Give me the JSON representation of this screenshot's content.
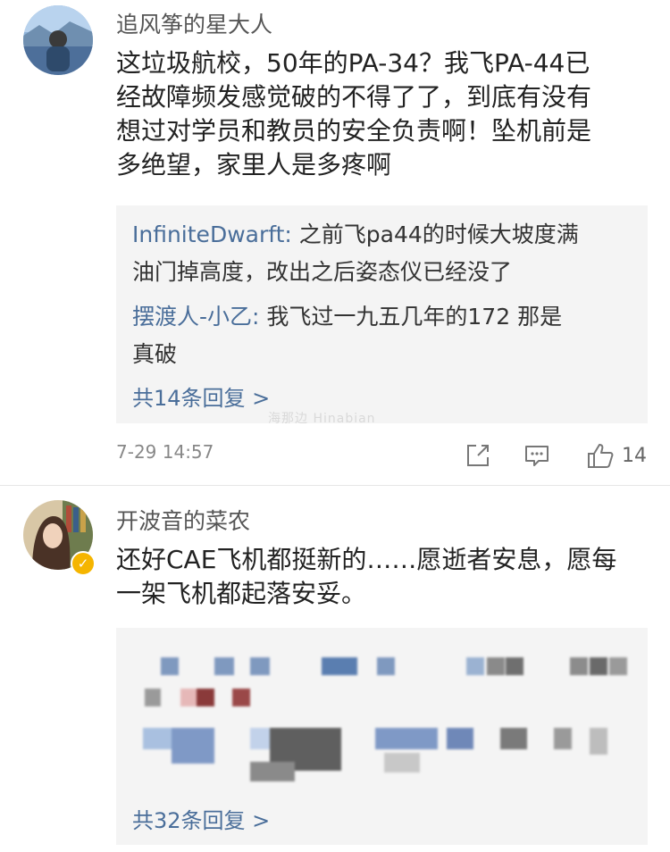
{
  "comments": [
    {
      "username": "追风筝的星大人",
      "content_lines": [
        "这垃圾航校，50年的PA-34？我飞PA-44已",
        "经故障频发感觉破的不得了了，到底有没有",
        "想过对学员和教员的安全负责啊！坠机前是",
        "多绝望，家里人是多疼啊"
      ],
      "replies": [
        {
          "name": "InfiniteDwarft:",
          "text_lines": [
            " 之前飞pa44的时候大坡度满",
            "油门掉高度，改出之后姿态仪已经没了"
          ]
        },
        {
          "name": "摆渡人-小乙:",
          "text_lines": [
            " 我飞过一九五几年的172 那是",
            "真破"
          ]
        }
      ],
      "more_replies": "共14条回复 >",
      "timestamp": "7-29 14:57",
      "like_count": "14"
    },
    {
      "username": "开波音的菜农",
      "content_lines": [
        "还好CAE飞机都挺新的……愿逝者安息，愿每",
        "一架飞机都起落安妥。"
      ],
      "more_replies": "共32条回复 >"
    }
  ],
  "watermark": "海那边 Hinabian",
  "colors": {
    "link_blue": "#4a6e9a",
    "reply_bg": "#f4f4f4",
    "verified_badge": "#f5b500"
  },
  "icons": [
    "share-icon",
    "comment-icon",
    "like-icon",
    "verified-icon"
  ]
}
